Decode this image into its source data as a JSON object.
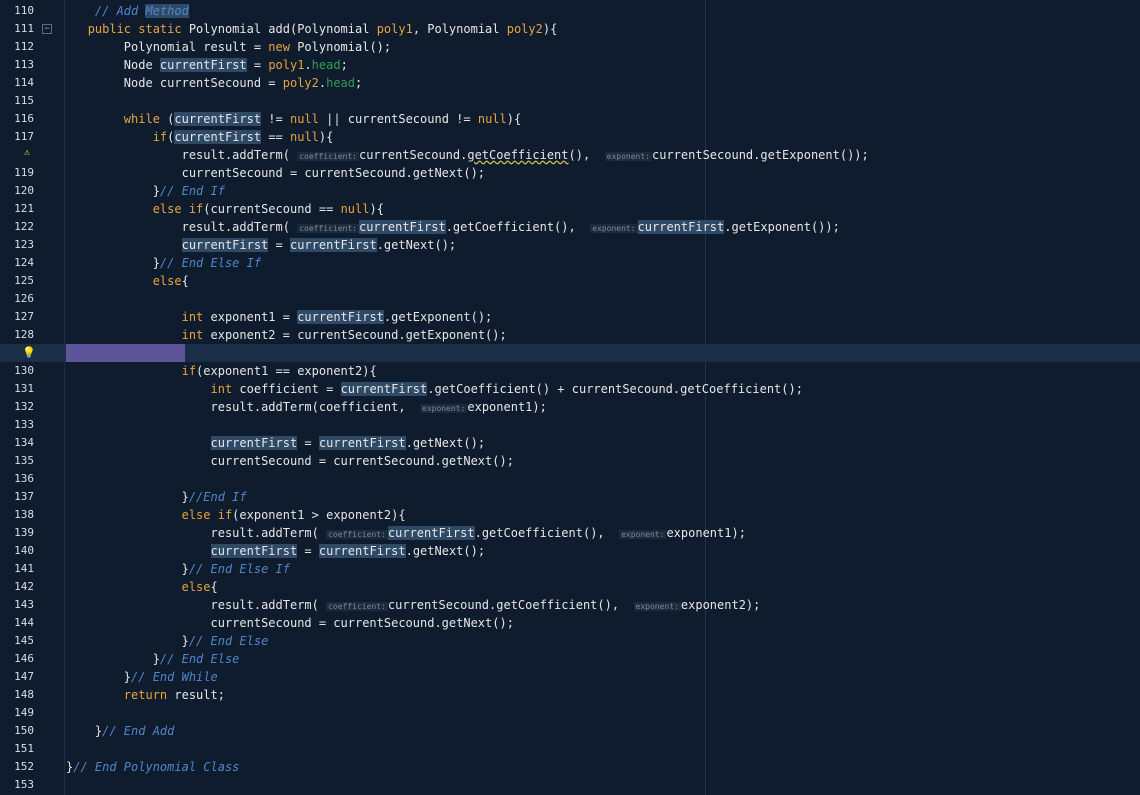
{
  "editor": {
    "lines": [
      {
        "n": "110"
      },
      {
        "n": "111"
      },
      {
        "n": "112"
      },
      {
        "n": "113"
      },
      {
        "n": "114"
      },
      {
        "n": "115"
      },
      {
        "n": "116"
      },
      {
        "n": "117"
      },
      {
        "n": ""
      },
      {
        "n": "119"
      },
      {
        "n": "120"
      },
      {
        "n": "121"
      },
      {
        "n": "122"
      },
      {
        "n": "123"
      },
      {
        "n": "124"
      },
      {
        "n": "125"
      },
      {
        "n": "126"
      },
      {
        "n": "127"
      },
      {
        "n": "128"
      },
      {
        "n": ""
      },
      {
        "n": "130"
      },
      {
        "n": "131"
      },
      {
        "n": "132"
      },
      {
        "n": "133"
      },
      {
        "n": "134"
      },
      {
        "n": "135"
      },
      {
        "n": "136"
      },
      {
        "n": "137"
      },
      {
        "n": "138"
      },
      {
        "n": "139"
      },
      {
        "n": "140"
      },
      {
        "n": "141"
      },
      {
        "n": "142"
      },
      {
        "n": "143"
      },
      {
        "n": "144"
      },
      {
        "n": "145"
      },
      {
        "n": "146"
      },
      {
        "n": "147"
      },
      {
        "n": "148"
      },
      {
        "n": "149"
      },
      {
        "n": "150"
      },
      {
        "n": "151"
      },
      {
        "n": "152"
      },
      {
        "n": "153"
      }
    ],
    "colors": {
      "background": "#0f1c2e",
      "keyword": "#e8a33c",
      "comment": "#4f86c9",
      "field": "#2f9e54",
      "usage_highlight": "#2f4a66",
      "selection_block": "#6a5aa8"
    },
    "icons": {
      "fold": "fold-minus-icon",
      "bulb": "lightbulb-icon",
      "warning": "warning-bulb-icon"
    }
  }
}
